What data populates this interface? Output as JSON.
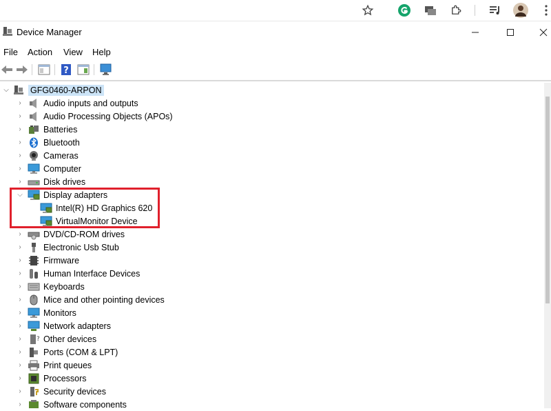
{
  "window": {
    "title": "Device Manager"
  },
  "menu": [
    "File",
    "Action",
    "View",
    "Help"
  ],
  "tree": {
    "root": "GFG0460-ARPON",
    "categories": [
      {
        "label": "Audio inputs and outputs",
        "icon": "speaker-icon"
      },
      {
        "label": "Audio Processing Objects (APOs)",
        "icon": "speaker-icon"
      },
      {
        "label": "Batteries",
        "icon": "battery-icon"
      },
      {
        "label": "Bluetooth",
        "icon": "bluetooth-icon"
      },
      {
        "label": "Cameras",
        "icon": "camera-icon"
      },
      {
        "label": "Computer",
        "icon": "computer-icon"
      },
      {
        "label": "Disk drives",
        "icon": "disk-icon"
      },
      {
        "label": "Display adapters",
        "icon": "display-adapter-icon",
        "expanded": true,
        "children": [
          "Intel(R) HD Graphics 620",
          "VirtualMonitor Device"
        ]
      },
      {
        "label": "DVD/CD-ROM drives",
        "icon": "dvd-icon"
      },
      {
        "label": "Electronic Usb Stub",
        "icon": "usb-icon"
      },
      {
        "label": "Firmware",
        "icon": "firmware-icon"
      },
      {
        "label": "Human Interface Devices",
        "icon": "hid-icon"
      },
      {
        "label": "Keyboards",
        "icon": "keyboard-icon"
      },
      {
        "label": "Mice and other pointing devices",
        "icon": "mouse-icon"
      },
      {
        "label": "Monitors",
        "icon": "monitor-icon"
      },
      {
        "label": "Network adapters",
        "icon": "network-icon"
      },
      {
        "label": "Other devices",
        "icon": "other-devices-icon"
      },
      {
        "label": "Ports (COM & LPT)",
        "icon": "port-icon"
      },
      {
        "label": "Print queues",
        "icon": "printer-icon"
      },
      {
        "label": "Processors",
        "icon": "processor-icon"
      },
      {
        "label": "Security devices",
        "icon": "security-icon"
      },
      {
        "label": "Software components",
        "icon": "software-icon"
      }
    ]
  },
  "colors": {
    "highlight": "#e0202c",
    "selection": "#cce4f7"
  }
}
